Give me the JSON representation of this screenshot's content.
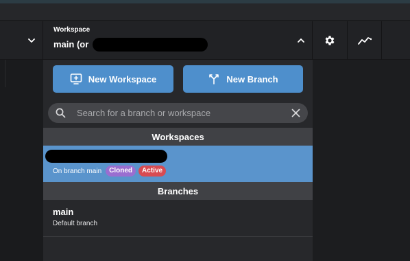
{
  "toolbar": {
    "workspace_caption": "Workspace",
    "workspace_name_prefix": "main (or"
  },
  "panel": {
    "new_workspace_label": "New Workspace",
    "new_branch_label": "New Branch",
    "search_placeholder": "Search for a branch or workspace",
    "workspaces_header": "Workspaces",
    "branches_header": "Branches",
    "workspace_items": [
      {
        "branch_text": "On branch main",
        "badges": [
          "Cloned",
          "Active"
        ]
      }
    ],
    "branch_items": [
      {
        "name": "main",
        "description": "Default branch"
      }
    ]
  },
  "colors": {
    "accent_blue": "#4e8fcc",
    "selected_row": "#5a94cc",
    "badge_cloned": "#9a6ed0",
    "badge_active": "#d84b52"
  },
  "icons": [
    "chevron-down-icon",
    "chevron-up-icon",
    "gear-icon",
    "activity-icon",
    "new-workspace-icon",
    "branch-icon",
    "search-icon",
    "clear-icon"
  ]
}
